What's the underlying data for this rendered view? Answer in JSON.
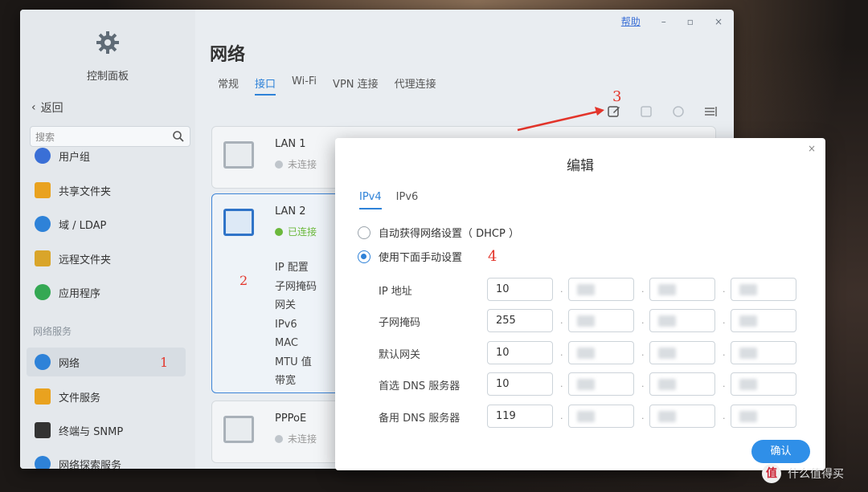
{
  "window": {
    "help_label": "帮助",
    "minimize": "–",
    "maximize": "▫",
    "close": "×"
  },
  "sidebar": {
    "title": "控制面板",
    "back_label": "返回",
    "search_placeholder": "搜索",
    "items": [
      {
        "label": "用户组",
        "icon": "users-icon",
        "color": "#3a6fd6"
      },
      {
        "label": "共享文件夹",
        "icon": "folder-icon",
        "color": "#e9a21f"
      },
      {
        "label": "域 / LDAP",
        "icon": "domain-icon",
        "color": "#2e82d8"
      },
      {
        "label": "远程文件夹",
        "icon": "remote-folder-icon",
        "color": "#d9a52a"
      },
      {
        "label": "应用程序",
        "icon": "apps-icon",
        "color": "#34a853"
      }
    ],
    "section_label": "网络服务",
    "section_items": [
      {
        "label": "网络",
        "icon": "network-icon",
        "color": "#2e82d8",
        "active": true,
        "marker": "1"
      },
      {
        "label": "文件服务",
        "icon": "file-service-icon",
        "color": "#e9a21f"
      },
      {
        "label": "终端与 SNMP",
        "icon": "terminal-icon",
        "color": "#333333"
      },
      {
        "label": "网络探索服务",
        "icon": "discovery-icon",
        "color": "#2e82d8"
      }
    ]
  },
  "main": {
    "title": "网络",
    "tabs": [
      "常规",
      "接口",
      "Wi-Fi",
      "VPN 连接",
      "代理连接"
    ],
    "active_tab": 1,
    "toolbar_marker": "3",
    "interfaces": [
      {
        "name": "LAN 1",
        "status": "未连接",
        "connected": false
      },
      {
        "name": "LAN 2",
        "status": "已连接",
        "connected": true,
        "marker": "2",
        "details": [
          "IP 配置",
          "子网掩码",
          "网关",
          "IPv6",
          "MAC",
          "MTU 值",
          "带宽"
        ]
      },
      {
        "name": "PPPoE",
        "status": "未连接",
        "connected": false
      }
    ]
  },
  "modal": {
    "title": "编辑",
    "close": "×",
    "tabs": [
      "IPv4",
      "IPv6"
    ],
    "active_tab": 0,
    "options": [
      {
        "label": "自动获得网络设置（ DHCP ）",
        "checked": false
      },
      {
        "label": "使用下面手动设置",
        "checked": true,
        "marker": "4"
      }
    ],
    "fields": [
      {
        "label": "IP 地址",
        "octets": [
          "10",
          "",
          "",
          ""
        ]
      },
      {
        "label": "子网掩码",
        "octets": [
          "255",
          "",
          "",
          ""
        ]
      },
      {
        "label": "默认网关",
        "octets": [
          "10",
          "",
          "",
          ""
        ]
      },
      {
        "label": "首选 DNS 服务器",
        "octets": [
          "10",
          "",
          "",
          ""
        ]
      },
      {
        "label": "备用 DNS 服务器",
        "octets": [
          "119",
          "",
          "",
          ""
        ]
      }
    ],
    "ok_label": "确认"
  },
  "watermark": {
    "badge": "值",
    "text": "什么值得买"
  },
  "colors": {
    "accent": "#2e82d8",
    "annotation": "#e3352b",
    "connected": "#6bb83c"
  }
}
